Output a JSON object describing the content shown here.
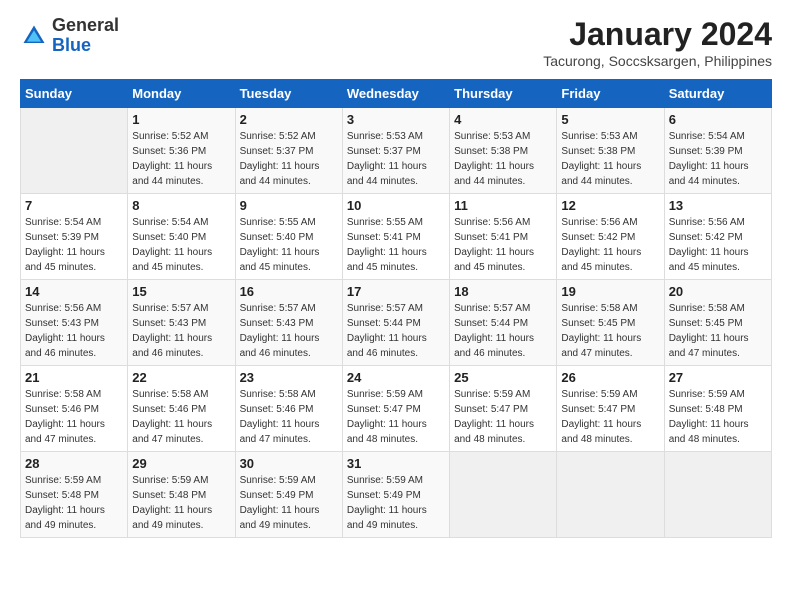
{
  "logo": {
    "general": "General",
    "blue": "Blue"
  },
  "title": "January 2024",
  "location": "Tacurong, Soccsksargen, Philippines",
  "days_header": [
    "Sunday",
    "Monday",
    "Tuesday",
    "Wednesday",
    "Thursday",
    "Friday",
    "Saturday"
  ],
  "weeks": [
    [
      {
        "day": "",
        "info": ""
      },
      {
        "day": "1",
        "info": "Sunrise: 5:52 AM\nSunset: 5:36 PM\nDaylight: 11 hours\nand 44 minutes."
      },
      {
        "day": "2",
        "info": "Sunrise: 5:52 AM\nSunset: 5:37 PM\nDaylight: 11 hours\nand 44 minutes."
      },
      {
        "day": "3",
        "info": "Sunrise: 5:53 AM\nSunset: 5:37 PM\nDaylight: 11 hours\nand 44 minutes."
      },
      {
        "day": "4",
        "info": "Sunrise: 5:53 AM\nSunset: 5:38 PM\nDaylight: 11 hours\nand 44 minutes."
      },
      {
        "day": "5",
        "info": "Sunrise: 5:53 AM\nSunset: 5:38 PM\nDaylight: 11 hours\nand 44 minutes."
      },
      {
        "day": "6",
        "info": "Sunrise: 5:54 AM\nSunset: 5:39 PM\nDaylight: 11 hours\nand 44 minutes."
      }
    ],
    [
      {
        "day": "7",
        "info": "Sunrise: 5:54 AM\nSunset: 5:39 PM\nDaylight: 11 hours\nand 45 minutes."
      },
      {
        "day": "8",
        "info": "Sunrise: 5:54 AM\nSunset: 5:40 PM\nDaylight: 11 hours\nand 45 minutes."
      },
      {
        "day": "9",
        "info": "Sunrise: 5:55 AM\nSunset: 5:40 PM\nDaylight: 11 hours\nand 45 minutes."
      },
      {
        "day": "10",
        "info": "Sunrise: 5:55 AM\nSunset: 5:41 PM\nDaylight: 11 hours\nand 45 minutes."
      },
      {
        "day": "11",
        "info": "Sunrise: 5:56 AM\nSunset: 5:41 PM\nDaylight: 11 hours\nand 45 minutes."
      },
      {
        "day": "12",
        "info": "Sunrise: 5:56 AM\nSunset: 5:42 PM\nDaylight: 11 hours\nand 45 minutes."
      },
      {
        "day": "13",
        "info": "Sunrise: 5:56 AM\nSunset: 5:42 PM\nDaylight: 11 hours\nand 45 minutes."
      }
    ],
    [
      {
        "day": "14",
        "info": "Sunrise: 5:56 AM\nSunset: 5:43 PM\nDaylight: 11 hours\nand 46 minutes."
      },
      {
        "day": "15",
        "info": "Sunrise: 5:57 AM\nSunset: 5:43 PM\nDaylight: 11 hours\nand 46 minutes."
      },
      {
        "day": "16",
        "info": "Sunrise: 5:57 AM\nSunset: 5:43 PM\nDaylight: 11 hours\nand 46 minutes."
      },
      {
        "day": "17",
        "info": "Sunrise: 5:57 AM\nSunset: 5:44 PM\nDaylight: 11 hours\nand 46 minutes."
      },
      {
        "day": "18",
        "info": "Sunrise: 5:57 AM\nSunset: 5:44 PM\nDaylight: 11 hours\nand 46 minutes."
      },
      {
        "day": "19",
        "info": "Sunrise: 5:58 AM\nSunset: 5:45 PM\nDaylight: 11 hours\nand 47 minutes."
      },
      {
        "day": "20",
        "info": "Sunrise: 5:58 AM\nSunset: 5:45 PM\nDaylight: 11 hours\nand 47 minutes."
      }
    ],
    [
      {
        "day": "21",
        "info": "Sunrise: 5:58 AM\nSunset: 5:46 PM\nDaylight: 11 hours\nand 47 minutes."
      },
      {
        "day": "22",
        "info": "Sunrise: 5:58 AM\nSunset: 5:46 PM\nDaylight: 11 hours\nand 47 minutes."
      },
      {
        "day": "23",
        "info": "Sunrise: 5:58 AM\nSunset: 5:46 PM\nDaylight: 11 hours\nand 47 minutes."
      },
      {
        "day": "24",
        "info": "Sunrise: 5:59 AM\nSunset: 5:47 PM\nDaylight: 11 hours\nand 48 minutes."
      },
      {
        "day": "25",
        "info": "Sunrise: 5:59 AM\nSunset: 5:47 PM\nDaylight: 11 hours\nand 48 minutes."
      },
      {
        "day": "26",
        "info": "Sunrise: 5:59 AM\nSunset: 5:47 PM\nDaylight: 11 hours\nand 48 minutes."
      },
      {
        "day": "27",
        "info": "Sunrise: 5:59 AM\nSunset: 5:48 PM\nDaylight: 11 hours\nand 48 minutes."
      }
    ],
    [
      {
        "day": "28",
        "info": "Sunrise: 5:59 AM\nSunset: 5:48 PM\nDaylight: 11 hours\nand 49 minutes."
      },
      {
        "day": "29",
        "info": "Sunrise: 5:59 AM\nSunset: 5:48 PM\nDaylight: 11 hours\nand 49 minutes."
      },
      {
        "day": "30",
        "info": "Sunrise: 5:59 AM\nSunset: 5:49 PM\nDaylight: 11 hours\nand 49 minutes."
      },
      {
        "day": "31",
        "info": "Sunrise: 5:59 AM\nSunset: 5:49 PM\nDaylight: 11 hours\nand 49 minutes."
      },
      {
        "day": "",
        "info": ""
      },
      {
        "day": "",
        "info": ""
      },
      {
        "day": "",
        "info": ""
      }
    ]
  ]
}
